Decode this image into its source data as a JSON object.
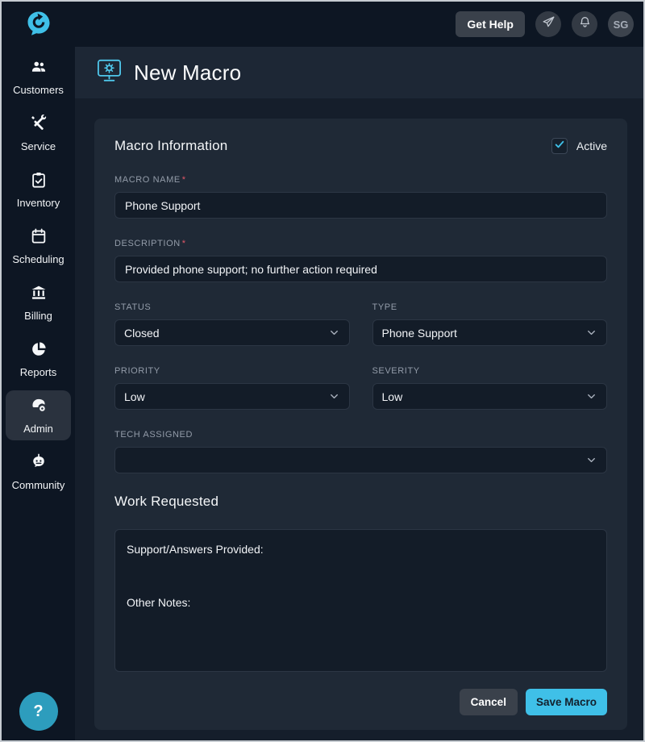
{
  "topbar": {
    "get_help_label": "Get Help",
    "avatar_initials": "SG"
  },
  "sidebar": {
    "items": [
      {
        "label": "Customers",
        "icon": "customers-icon",
        "active": false
      },
      {
        "label": "Service",
        "icon": "service-icon",
        "active": false
      },
      {
        "label": "Inventory",
        "icon": "inventory-icon",
        "active": false
      },
      {
        "label": "Scheduling",
        "icon": "scheduling-icon",
        "active": false
      },
      {
        "label": "Billing",
        "icon": "billing-icon",
        "active": false
      },
      {
        "label": "Reports",
        "icon": "reports-icon",
        "active": false
      },
      {
        "label": "Admin",
        "icon": "admin-icon",
        "active": true
      },
      {
        "label": "Community",
        "icon": "community-icon",
        "active": false
      }
    ],
    "help_label": "?"
  },
  "header": {
    "title": "New Macro",
    "icon": "monitor-gear-icon"
  },
  "form": {
    "section_title": "Macro Information",
    "required_marker": "*",
    "active_checkbox": {
      "label": "Active",
      "checked": true
    },
    "fields": {
      "macro_name": {
        "label": "MACRO NAME",
        "required": true,
        "value": "Phone Support"
      },
      "description": {
        "label": "DESCRIPTION",
        "required": true,
        "value": "Provided phone support; no further action required"
      },
      "status": {
        "label": "STATUS",
        "value": "Closed"
      },
      "type": {
        "label": "TYPE",
        "value": "Phone Support"
      },
      "priority": {
        "label": "PRIORITY",
        "value": "Low"
      },
      "severity": {
        "label": "SEVERITY",
        "value": "Low"
      },
      "tech_assigned": {
        "label": "TECH ASSIGNED",
        "value": ""
      }
    },
    "work_requested": {
      "section_title": "Work Requested",
      "value": "Support/Answers Provided:\n\n\nOther Notes:"
    },
    "buttons": {
      "cancel": "Cancel",
      "save": "Save Macro"
    }
  },
  "colors": {
    "accent": "#3fc0e8",
    "sidebar_bg": "#0d1623",
    "card_bg": "#1f2936",
    "input_bg": "#131c28",
    "required_marker": "#e25768",
    "save_button_bg": "#3fc0e8",
    "help_circle_bg": "#2d9dbd"
  }
}
